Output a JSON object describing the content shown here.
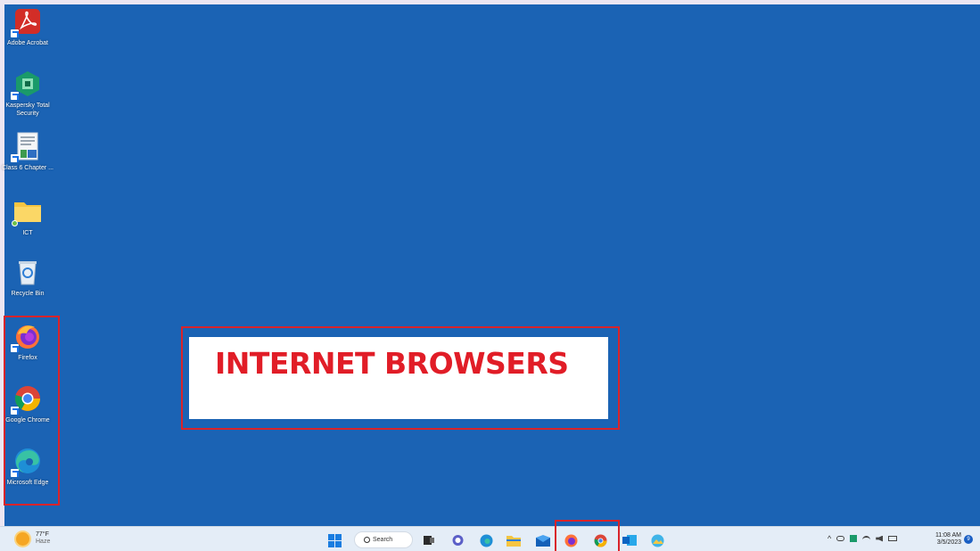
{
  "desktop": {
    "background_color": "#1b63b4",
    "icons": [
      {
        "label": "Adobe Acrobat",
        "icon": "adobe-acrobat-icon"
      },
      {
        "label": "Kaspersky Total Security",
        "icon": "kaspersky-icon"
      },
      {
        "label": "Class 6 Chapter ...",
        "icon": "document-icon"
      },
      {
        "label": "ICT",
        "icon": "folder-icon"
      },
      {
        "label": "Recycle Bin",
        "icon": "recycle-bin-icon"
      },
      {
        "label": "Firefox",
        "icon": "firefox-icon"
      },
      {
        "label": "Google Chrome",
        "icon": "chrome-icon"
      },
      {
        "label": "Microsoft Edge",
        "icon": "edge-icon"
      }
    ],
    "banner_text": "INTERNET BROWSERS",
    "highlight_color": "#d9232a"
  },
  "taskbar": {
    "weather": {
      "temp": "77°F",
      "condition": "Haze"
    },
    "search_label": "Search",
    "apps": [
      "start-icon",
      "search",
      "task-view-icon",
      "chat-icon",
      "edge-icon",
      "file-explorer-icon",
      "mail-icon",
      "firefox-icon",
      "chrome-icon",
      "outlook-icon",
      "photos-icon"
    ],
    "clock": {
      "time": "11:08 AM",
      "date": "3/5/2023"
    },
    "notification_count": "9"
  }
}
